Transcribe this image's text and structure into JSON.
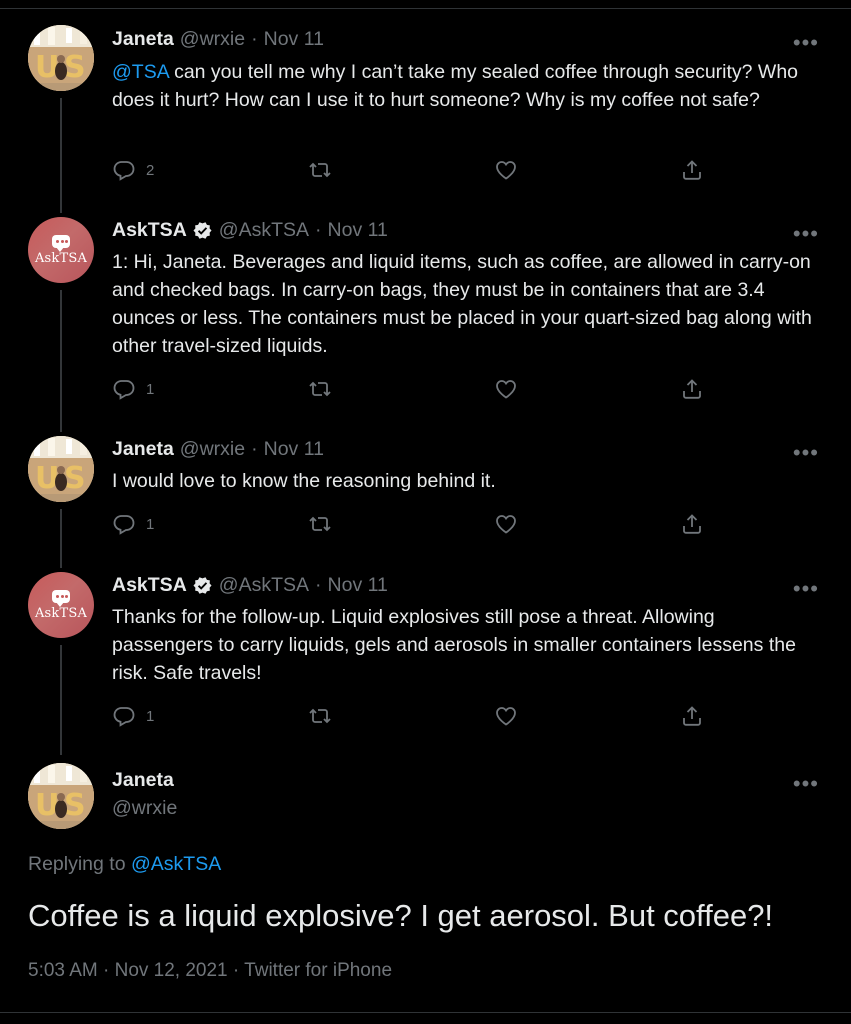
{
  "tweets": [
    {
      "name": "Janeta",
      "handle": "@wrxie",
      "sep": "·",
      "date": "Nov 11",
      "mention": "@TSA",
      "text": " can you tell me why I can’t take my sealed coffee through security? Who does it hurt? How can I use it to hurt someone? Why is my coffee not safe?",
      "reply_count": "2",
      "more": "•••"
    },
    {
      "name": "AskTSA",
      "verified": true,
      "avatar_text": "AskTSA",
      "handle": "@AskTSA",
      "sep": "·",
      "date": "Nov 11",
      "text": "1: Hi, Janeta. Beverages and liquid items, such as coffee, are allowed in carry-on and checked bags. In carry-on bags, they must be in containers that are 3.4 ounces or less. The containers must be placed in your quart-sized bag along with other travel-sized liquids.",
      "reply_count": "1",
      "more": "•••"
    },
    {
      "name": "Janeta",
      "handle": "@wrxie",
      "sep": "·",
      "date": "Nov 11",
      "text": "I would love to know the reasoning behind it.",
      "reply_count": "1",
      "more": "•••"
    },
    {
      "name": "AskTSA",
      "verified": true,
      "avatar_text": "AskTSA",
      "handle": "@AskTSA",
      "sep": "·",
      "date": "Nov 11",
      "text": "Thanks for the follow-up. Liquid explosives still pose a threat. Allowing passengers to carry liquids, gels and aerosols in smaller containers lessens the risk. Safe travels!",
      "reply_count": "1",
      "more": "•••"
    }
  ],
  "main": {
    "name": "Janeta",
    "handle": "@wrxie",
    "more": "•••",
    "replying_prefix": "Replying to ",
    "replying_handle": "@AskTSA",
    "text": "Coffee is a liquid explosive? I get aerosol. But coffee?!",
    "timestamp": "5:03 AM · Nov 12, 2021 · Twitter for iPhone"
  },
  "colors": {
    "background": "#000000",
    "text": "#e7e9ea",
    "muted": "#71767b",
    "link": "#1d9bf0",
    "verified_badge": "#e7e9ea"
  },
  "icons": [
    "reply-icon",
    "retweet-icon",
    "like-icon",
    "share-icon",
    "verified-icon",
    "more-icon"
  ]
}
